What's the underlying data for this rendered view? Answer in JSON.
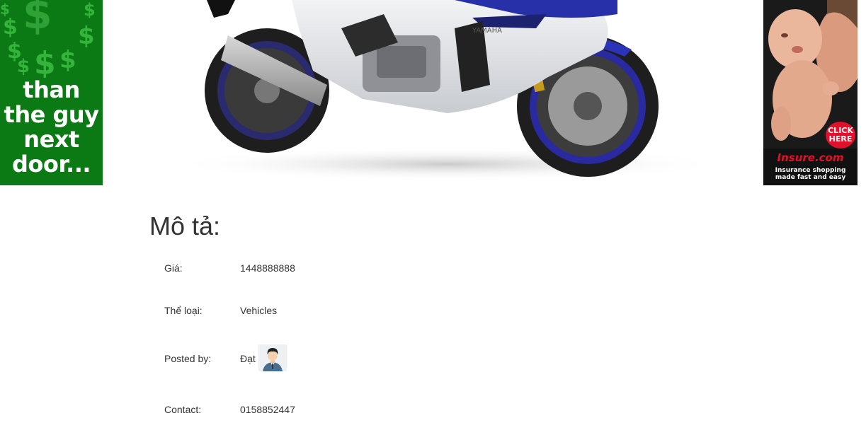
{
  "ads": {
    "left": {
      "text_lines": [
        "than",
        "the guy",
        "next",
        "door..."
      ],
      "background": "#0b7a14"
    },
    "right": {
      "badge_line1": "CLICK",
      "badge_line2": "HERE",
      "brand": "Insure.com",
      "tagline_line1": "Insurance shopping",
      "tagline_line2": "made fast and easy"
    }
  },
  "product": {
    "image_icon": "motorcycle-image"
  },
  "description": {
    "title": "Mô tả:",
    "rows": {
      "price": {
        "label": "Giá:",
        "value": "1448888888"
      },
      "category": {
        "label": "Thể loại:",
        "value": "Vehicles"
      },
      "posted_by": {
        "label": "Posted by:",
        "value": "Đạt",
        "avatar_icon": "user-avatar-icon"
      },
      "contact": {
        "label": "Contact:",
        "value": "0158852447"
      }
    }
  }
}
